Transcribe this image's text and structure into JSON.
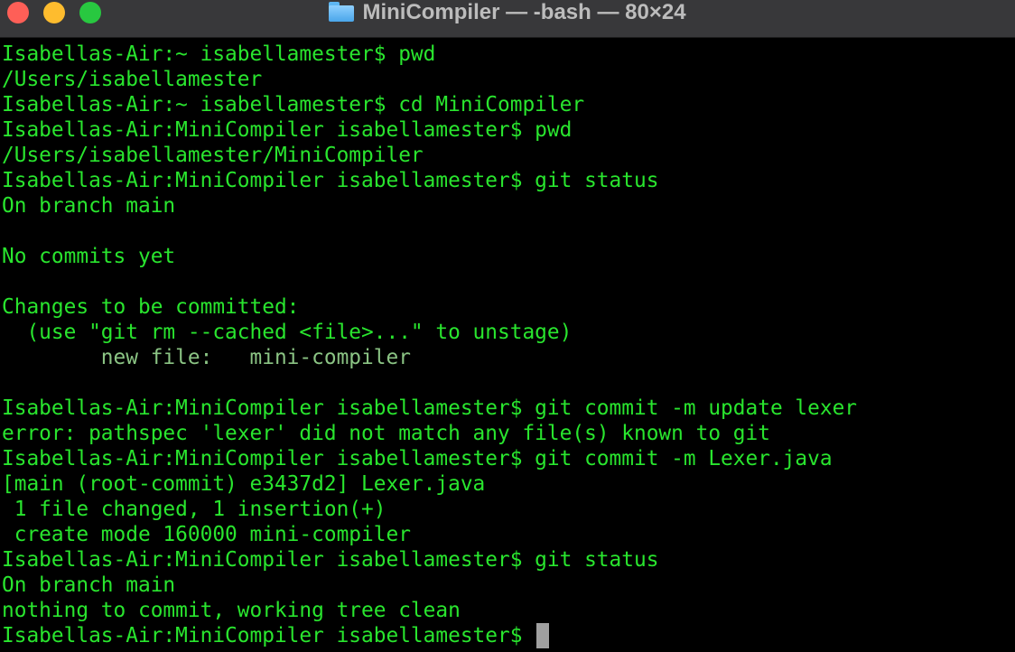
{
  "window": {
    "title": "MiniCompiler — -bash — 80×24",
    "title_icon": "folder-icon",
    "controls": [
      "close",
      "minimize",
      "zoom"
    ]
  },
  "colors": {
    "background": "#000000",
    "text": "#29e52e",
    "dim_text": "#8bc484",
    "titlebar": "#38383a",
    "close": "#fe5f57",
    "minimize": "#febc2e",
    "zoom": "#28c840"
  },
  "terminal": {
    "lines": [
      "Isabellas-Air:~ isabellamester$ pwd",
      "/Users/isabellamester",
      "Isabellas-Air:~ isabellamester$ cd MiniCompiler",
      "Isabellas-Air:MiniCompiler isabellamester$ pwd",
      "/Users/isabellamester/MiniCompiler",
      "Isabellas-Air:MiniCompiler isabellamester$ git status",
      "On branch main",
      "",
      "No commits yet",
      "",
      "Changes to be committed:",
      "  (use \"git rm --cached <file>...\" to unstage)",
      "        new file:   mini-compiler",
      "",
      "Isabellas-Air:MiniCompiler isabellamester$ git commit -m update lexer",
      "error: pathspec 'lexer' did not match any file(s) known to git",
      "Isabellas-Air:MiniCompiler isabellamester$ git commit -m Lexer.java",
      "[main (root-commit) e3437d2] Lexer.java",
      " 1 file changed, 1 insertion(+)",
      " create mode 160000 mini-compiler",
      "Isabellas-Air:MiniCompiler isabellamester$ git status",
      "On branch main",
      "nothing to commit, working tree clean"
    ],
    "prompt": "Isabellas-Air:MiniCompiler isabellamester$ "
  }
}
